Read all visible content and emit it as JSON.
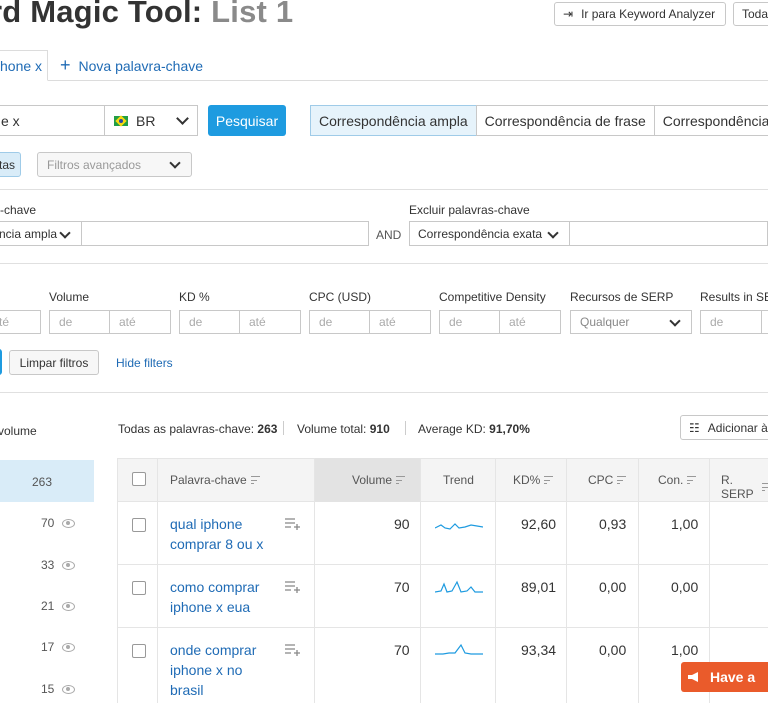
{
  "header": {
    "title_main": "rd Magic Tool:",
    "title_list": "List 1",
    "btn_analyzer": "Ir para Keyword Analyzer",
    "btn_todas": "Toda"
  },
  "tabs": {
    "active": "hone x",
    "new": "Nova palavra-chave"
  },
  "search": {
    "value": "e x",
    "country": "BR",
    "submit": "Pesquisar"
  },
  "match_types": [
    "Correspondência ampla",
    "Correspondência de frase",
    "Correspondência"
  ],
  "filters": {
    "tag_partial": "tas",
    "advanced": "Filtros avançados",
    "include_label": "-chave",
    "include_match": "ncia ampla",
    "and_label": "AND",
    "exclude_label": "Excluir palavras-chave",
    "exclude_match": "Correspondência exata",
    "range_from": "de",
    "range_to": "até",
    "partial_to": "té",
    "volume": "Volume",
    "kd": "KD %",
    "cpc": "CPC (USD)",
    "density": "Competitive Density",
    "serp": "Recursos de SERP",
    "serp_value": "Qualquer",
    "results": "Results in SE",
    "clear": "Limpar filtros",
    "hide": "Hide filters"
  },
  "summary": {
    "sidebar_label": "volume",
    "all_keywords_label": "Todas as palavras-chave:",
    "all_keywords_value": "263",
    "total_volume_label": "Volume total:",
    "total_volume_value": "910",
    "avg_kd_label": "Average KD:",
    "avg_kd_value": "91,70%",
    "add_btn": "Adicionar à"
  },
  "sidebar": [
    {
      "value": "263"
    },
    {
      "value": "70"
    },
    {
      "value": "33"
    },
    {
      "value": "21"
    },
    {
      "value": "17"
    },
    {
      "value": "15"
    }
  ],
  "table": {
    "columns": [
      "Palavra-chave",
      "Volume",
      "Trend",
      "KD%",
      "CPC",
      "Con.",
      "R. SERP"
    ],
    "rows": [
      {
        "kw1": "qual iphone",
        "kw2": "comprar 8 ou x",
        "kw3": "",
        "volume": "90",
        "kd": "92,60",
        "cpc": "0,93",
        "con": "1,00"
      },
      {
        "kw1": "como comprar",
        "kw2": "iphone x eua",
        "kw3": "",
        "volume": "70",
        "kd": "89,01",
        "cpc": "0,00",
        "con": "0,00"
      },
      {
        "kw1": "onde comprar",
        "kw2": "iphone x no",
        "kw3": "brasil",
        "volume": "70",
        "kd": "93,34",
        "cpc": "0,00",
        "con": "1,00"
      }
    ]
  },
  "feedback": {
    "label": "Have a"
  },
  "colors": {
    "accent": "#1e9be0",
    "link": "#1f6bb5",
    "feedback": "#ea5b2b",
    "selected": "#e6f3fb"
  }
}
